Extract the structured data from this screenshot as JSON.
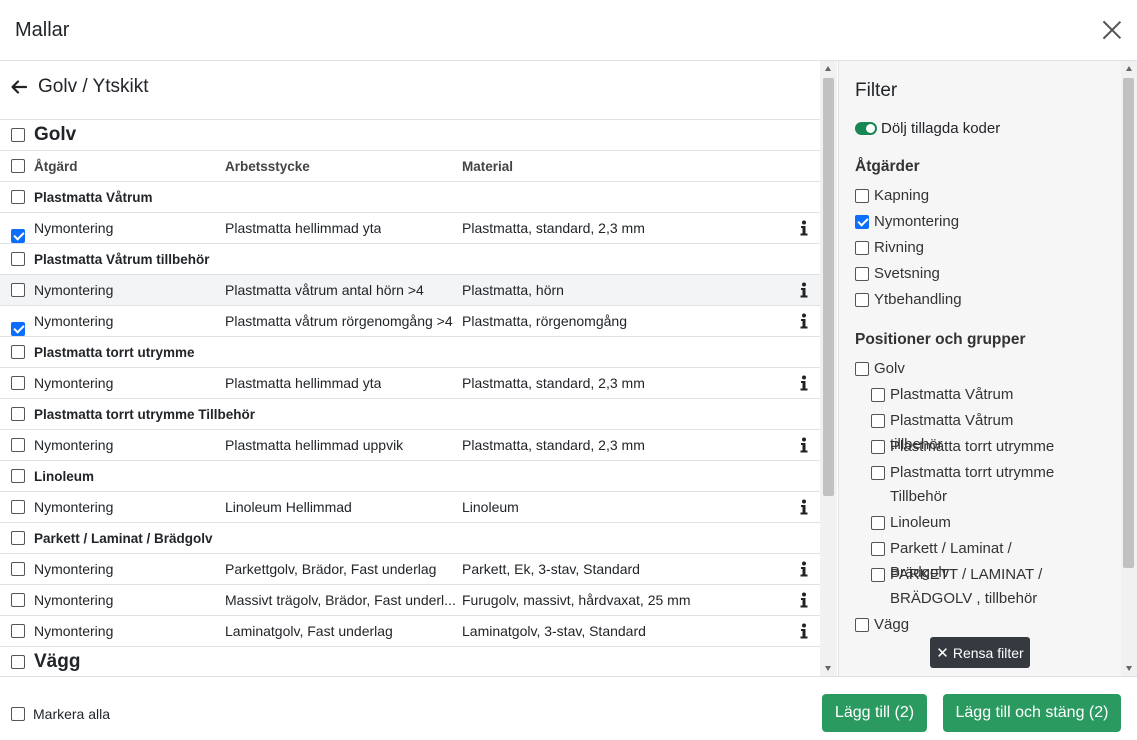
{
  "modal": {
    "title": "Mallar"
  },
  "breadcrumb": {
    "label": "Golv / Ytskikt"
  },
  "table": {
    "section_top": "Golv",
    "headers": [
      "Åtgärd",
      "Arbetsstycke",
      "Material"
    ],
    "rows": [
      {
        "type": "group",
        "label": "Plastmatta Våtrum",
        "checked": false
      },
      {
        "type": "item",
        "c1": "Nymontering",
        "c2": "Plastmatta hellimmad yta",
        "c3": "Plastmatta, standard, 2,3 mm",
        "checked": true
      },
      {
        "type": "group",
        "label": "Plastmatta Våtrum tillbehör",
        "checked": false
      },
      {
        "type": "item",
        "c1": "Nymontering",
        "c2": "Plastmatta våtrum antal hörn >4",
        "c3": "Plastmatta, hörn",
        "checked": false,
        "alt": true
      },
      {
        "type": "item",
        "c1": "Nymontering",
        "c2": "Plastmatta våtrum rörgenomgång >4",
        "c3": "Plastmatta, rörgenomgång",
        "checked": true
      },
      {
        "type": "group",
        "label": "Plastmatta torrt utrymme",
        "checked": false
      },
      {
        "type": "item",
        "c1": "Nymontering",
        "c2": "Plastmatta hellimmad yta",
        "c3": "Plastmatta, standard, 2,3 mm",
        "checked": false
      },
      {
        "type": "group",
        "label": "Plastmatta torrt utrymme Tillbehör",
        "checked": false
      },
      {
        "type": "item",
        "c1": "Nymontering",
        "c2": "Plastmatta hellimmad uppvik",
        "c3": "Plastmatta, standard, 2,3 mm",
        "checked": false
      },
      {
        "type": "group",
        "label": "Linoleum",
        "checked": false
      },
      {
        "type": "item",
        "c1": "Nymontering",
        "c2": "Linoleum Hellimmad",
        "c3": "Linoleum",
        "checked": false
      },
      {
        "type": "group",
        "label": "Parkett / Laminat / Brädgolv",
        "checked": false
      },
      {
        "type": "item",
        "c1": "Nymontering",
        "c2": "Parkettgolv, Brädor, Fast underlag",
        "c3": "Parkett, Ek, 3-stav, Standard",
        "checked": false
      },
      {
        "type": "item",
        "c1": "Nymontering",
        "c2": "Massivt trägolv, Brädor, Fast underl...",
        "c3": "Furugolv, massivt, hårdvaxat, 25 mm",
        "checked": false
      },
      {
        "type": "item",
        "c1": "Nymontering",
        "c2": "Laminatgolv, Fast underlag",
        "c3": "Laminatgolv, 3-stav, Standard",
        "checked": false
      },
      {
        "type": "section",
        "label": "Vägg",
        "checked": false
      }
    ]
  },
  "filter": {
    "title": "Filter",
    "toggle_label": "Dölj tillagda koder",
    "toggle_on": true,
    "atgarder_heading": "Åtgärder",
    "atgarder": [
      {
        "label": "Kapning",
        "checked": false
      },
      {
        "label": "Nymontering",
        "checked": true
      },
      {
        "label": "Rivning",
        "checked": false
      },
      {
        "label": "Svetsning",
        "checked": false
      },
      {
        "label": "Ytbehandling",
        "checked": false
      }
    ],
    "positioner_heading": "Positioner och grupper",
    "positioner": [
      {
        "label": "Golv",
        "level": 0,
        "checked": false
      },
      {
        "label": "Plastmatta Våtrum",
        "level": 1,
        "checked": false
      },
      {
        "label": "Plastmatta Våtrum tillbehör",
        "level": 1,
        "checked": false
      },
      {
        "label": "Plastmatta torrt utrymme",
        "level": 1,
        "checked": false
      },
      {
        "label": "Plastmatta torrt utrymme Tillbehör",
        "level": 1,
        "checked": false
      },
      {
        "label": "Linoleum",
        "level": 1,
        "checked": false
      },
      {
        "label": "Parkett / Laminat / Brädgolv",
        "level": 1,
        "checked": false
      },
      {
        "label": "PARKETT / LAMINAT / BRÄDGOLV , tillbehör",
        "level": 1,
        "checked": false
      },
      {
        "label": "Vägg",
        "level": 0,
        "checked": false
      }
    ],
    "clear_label": "Rensa filter"
  },
  "footer": {
    "select_all_label": "Markera alla",
    "add_label": "Lägg till (2)",
    "add_close_label": "Lägg till och stäng (2)"
  },
  "colors": {
    "accent": "#0d6efd",
    "success": "#2a9a60",
    "dark": "#343a40"
  }
}
